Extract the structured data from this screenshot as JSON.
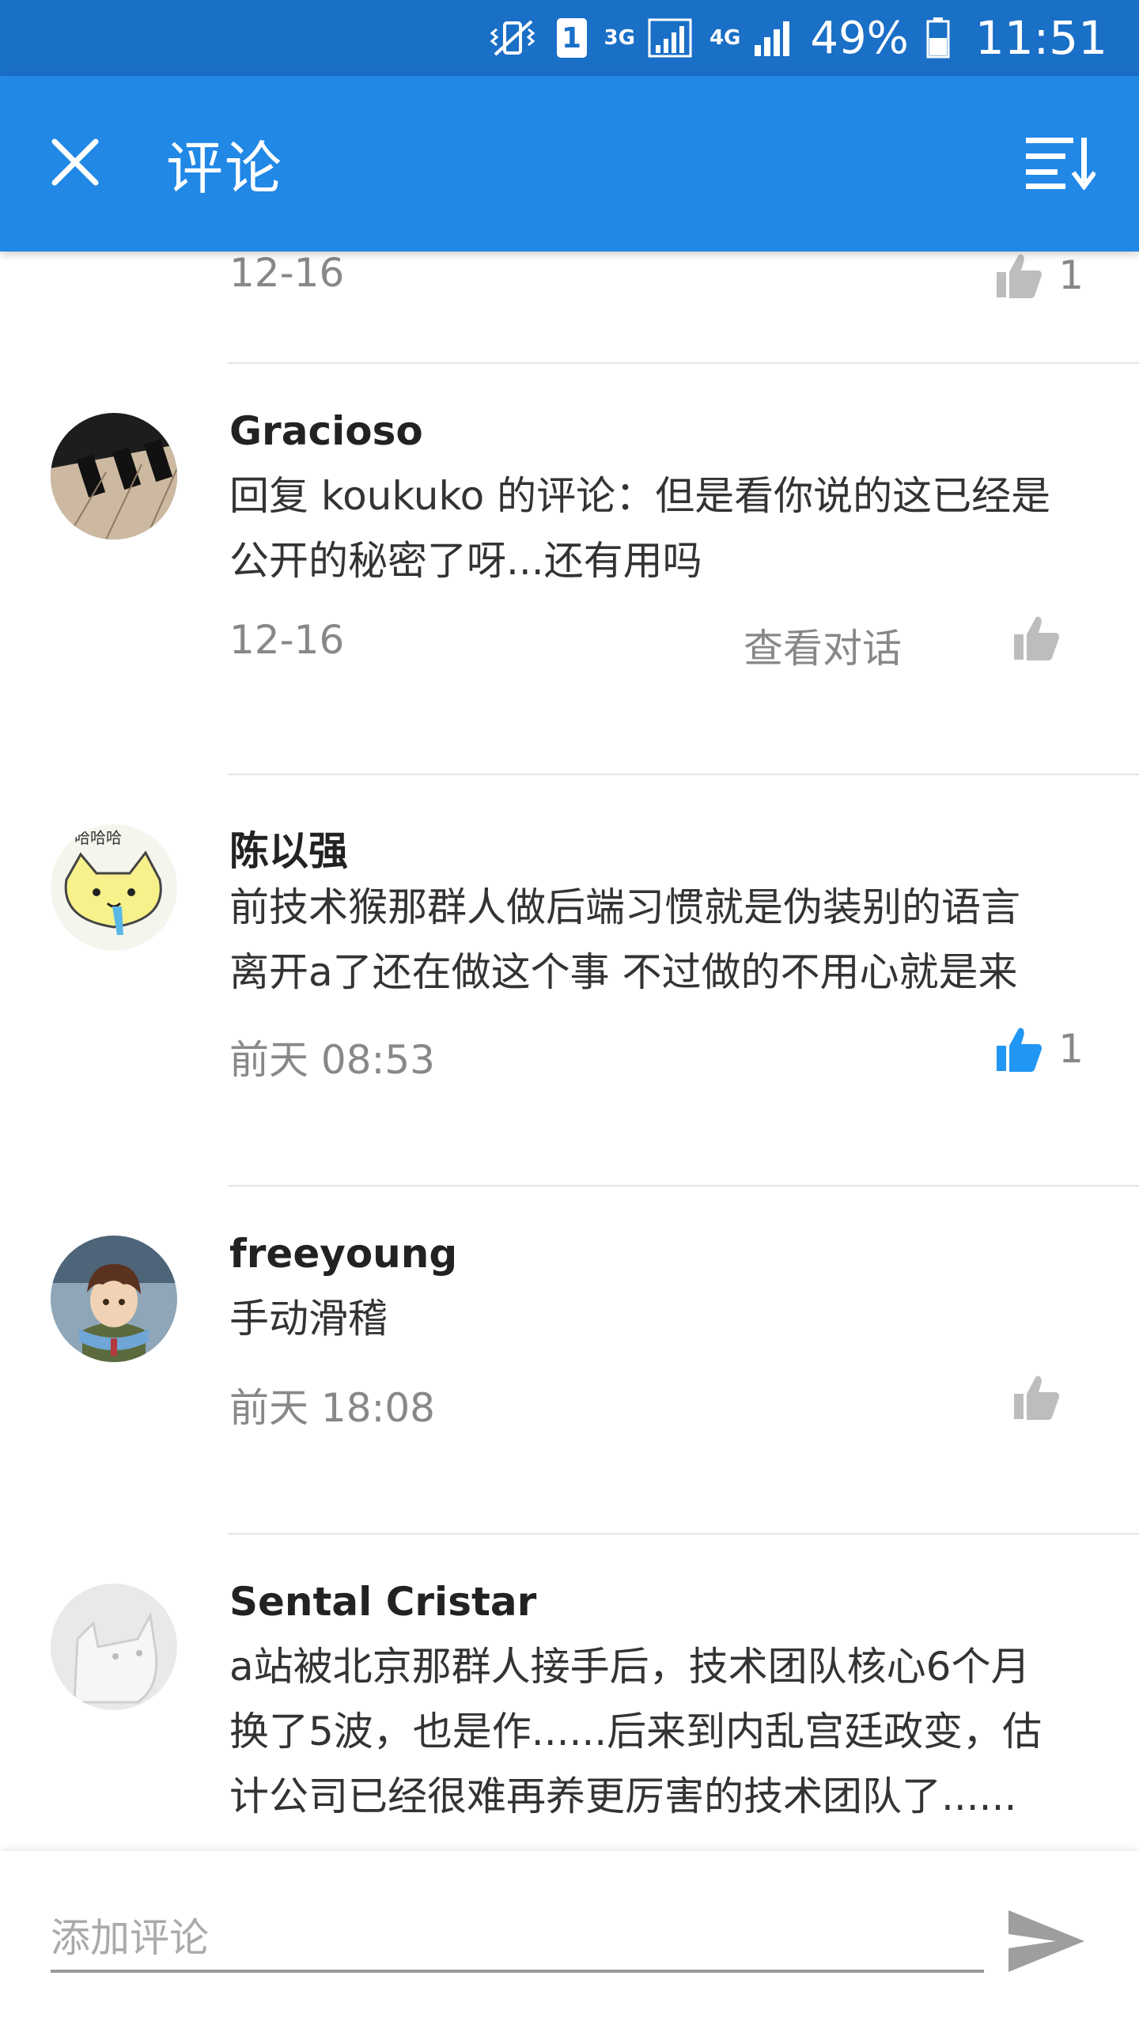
{
  "status_bar": {
    "sim_slot": "1",
    "net1": "3G",
    "net2": "4G",
    "battery": "49%",
    "time": "11:51"
  },
  "header": {
    "title": "评论"
  },
  "comments": [
    {
      "user": "",
      "content": "",
      "time": "12-16",
      "view_conversation": "",
      "likes": "1"
    },
    {
      "user": "Gracioso",
      "content": "回复 koukuko 的评论：但是看你说的这已经是\n公开的秘密了呀...还有用吗",
      "time": "12-16",
      "view_conversation": "查看对话",
      "likes": ""
    },
    {
      "user": "陈以强",
      "content": "前技术猴那群人做后端习惯就是伪装别的语言\n离开a了还在做这个事 不过做的不用心就是来",
      "time": "前天 08:53",
      "view_conversation": "",
      "likes": "1"
    },
    {
      "user": "freeyoung",
      "content": "手动滑稽",
      "time": "前天 18:08",
      "view_conversation": "",
      "likes": ""
    },
    {
      "user": "Sental Cristar",
      "content": "a站被北京那群人接手后，技术团队核心6个月\n换了5波，也是作......后来到内乱宫廷政变，估\n计公司已经很难再养更厉害的技术团队了......",
      "time": "",
      "view_conversation": "",
      "likes": ""
    }
  ],
  "composer": {
    "placeholder": "添加评论"
  },
  "colors": {
    "status_bar": "#1a6fc7",
    "app_bar": "#2188e6",
    "like_active": "#2196f3",
    "like_inactive": "#bdbdbd"
  }
}
